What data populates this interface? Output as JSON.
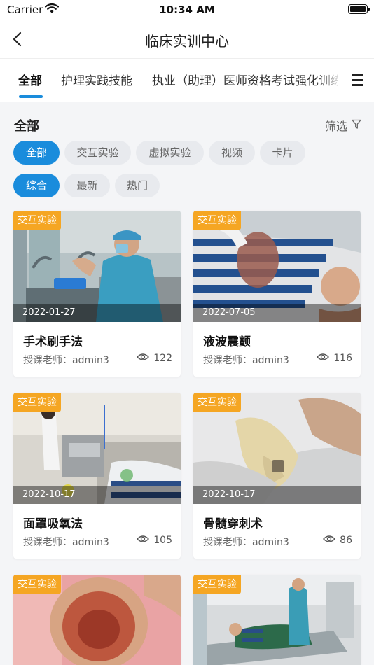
{
  "status_bar": {
    "carrier": "Carrier",
    "time": "10:34 AM"
  },
  "nav": {
    "title": "临床实训中心",
    "back_icon": "chevron-left-icon"
  },
  "tabs": {
    "items": [
      {
        "label": "全部",
        "active": true
      },
      {
        "label": "护理实践技能",
        "active": false
      },
      {
        "label": "执业（助理）医师资格考试强化训练",
        "active": false
      }
    ],
    "menu_icon": "hamburger-menu-icon",
    "accent_color": "#1a8cdc"
  },
  "section": {
    "title": "全部",
    "filter_label": "筛选",
    "filter_icon": "funnel-icon"
  },
  "type_chips": [
    {
      "label": "全部",
      "active": true
    },
    {
      "label": "交互实验",
      "active": false
    },
    {
      "label": "虚拟实验",
      "active": false
    },
    {
      "label": "视频",
      "active": false
    },
    {
      "label": "卡片",
      "active": false
    }
  ],
  "sort_chips": [
    {
      "label": "综合",
      "active": true
    },
    {
      "label": "最新",
      "active": false
    },
    {
      "label": "热门",
      "active": false
    }
  ],
  "cards": [
    {
      "badge": "交互实验",
      "date": "2022-01-27",
      "name": "手术刷手法",
      "teacher": "授课老师：admin3",
      "views": "122"
    },
    {
      "badge": "交互实验",
      "date": "2022-07-05",
      "name": "液波震颤",
      "teacher": "授课老师：admin3",
      "views": "116"
    },
    {
      "badge": "交互实验",
      "date": "2022-10-17",
      "name": "面罩吸氧法",
      "teacher": "授课老师：admin3",
      "views": "105"
    },
    {
      "badge": "交互实验",
      "date": "2022-10-17",
      "name": "骨髓穿刺术",
      "teacher": "授课老师：admin3",
      "views": "86"
    },
    {
      "badge": "交互实验"
    },
    {
      "badge": "交互实验"
    }
  ],
  "colors": {
    "badge": "#f5a623",
    "chip_active": "#1a8cdc",
    "chip_inactive": "#e8eaee"
  }
}
